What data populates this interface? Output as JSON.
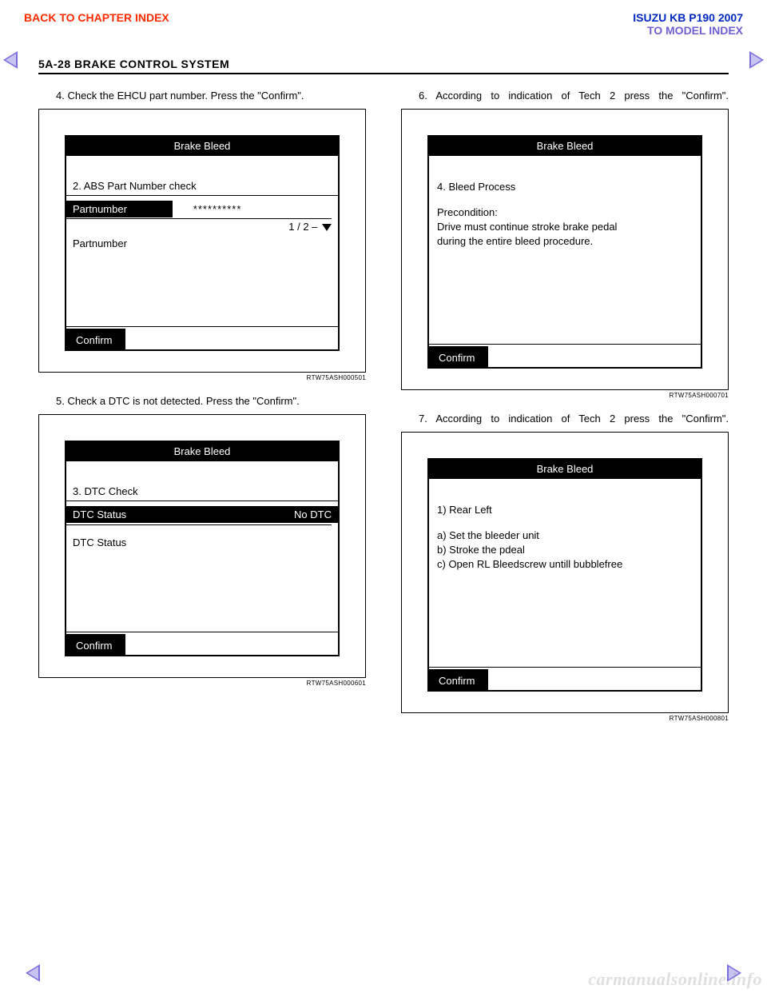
{
  "header": {
    "back_link": "BACK TO CHAPTER INDEX",
    "model_title": "ISUZU KB P190 2007",
    "model_index_link": "TO MODEL INDEX",
    "page_heading": "5A-28   BRAKE CONTROL SYSTEM"
  },
  "left_column": {
    "step4_text": "4. Check the EHCU part number. Press the \"Confirm\".",
    "fig1": {
      "title": "Brake Bleed",
      "step_label": "2. ABS Part Number  check",
      "partnumber_label": "Partnumber",
      "partnumber_value": "**********",
      "page_indicator": "1 / 2 – ",
      "lower_label": "Partnumber",
      "confirm": "Confirm",
      "caption": "RTW75ASH000501"
    },
    "step5_text": "5. Check a DTC is not detected. Press the \"Confirm\".",
    "fig2": {
      "title": "Brake Bleed",
      "step_label": "3. DTC Check",
      "status_label": "DTC Status",
      "status_value": "No DTC",
      "lower_label": "DTC Status",
      "confirm": "Confirm",
      "caption": "RTW75ASH000601"
    }
  },
  "right_column": {
    "step6_text": "6. According to indication of Tech 2 press the \"Confirm\".",
    "fig3": {
      "title": "Brake Bleed",
      "heading": "4. Bleed Process",
      "pre_label": "Precondition:",
      "pre_line1": "Drive must continue stroke brake pedal",
      "pre_line2": "during the entire bleed procedure.",
      "confirm": "Confirm",
      "caption": "RTW75ASH000701"
    },
    "step7_text": "7. According to indication of Tech 2 press the \"Confirm\".",
    "fig4": {
      "title": "Brake Bleed",
      "heading": "1) Rear Left",
      "line_a": "a) Set the bleeder unit",
      "line_b": "b) Stroke the pdeal",
      "line_c": "c) Open RL Bleedscrew untill bubblefree",
      "confirm": "Confirm",
      "caption": "RTW75ASH000801"
    }
  },
  "watermark": "carmanualsonline.info"
}
